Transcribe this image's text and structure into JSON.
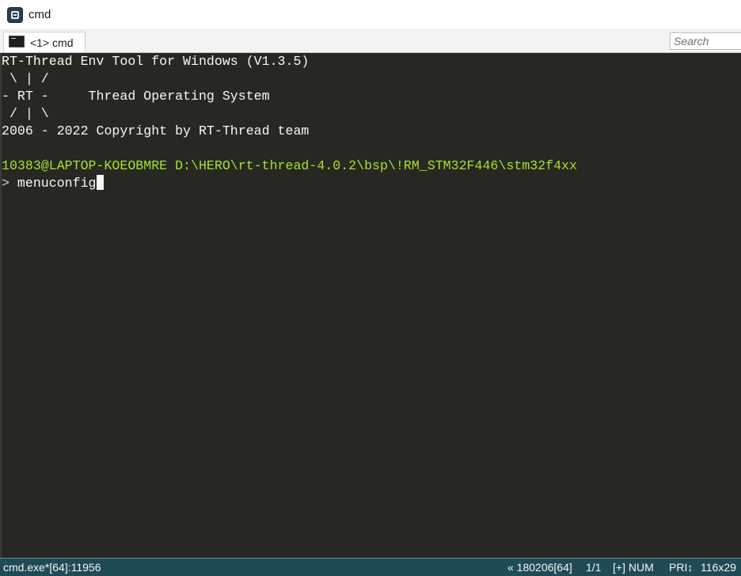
{
  "window": {
    "title": "cmd",
    "app_icon": "conemu-app-icon"
  },
  "tabs": [
    {
      "label": "<1> cmd",
      "icon": "console-icon",
      "active": true
    }
  ],
  "search": {
    "placeholder": "Search",
    "value": ""
  },
  "terminal": {
    "background": "#272822",
    "foreground": "#f8f8f2",
    "prompt_color": "#a6e22e",
    "lines": [
      "RT-Thread Env Tool for Windows (V1.3.5)",
      " \\ | /",
      "- RT -     Thread Operating System",
      " / | \\",
      "2006 - 2022 Copyright by RT-Thread team",
      "",
      ""
    ],
    "prompt_user": "10383@LAPTOP-KOEOBMRE",
    "prompt_path": "D:\\HERO\\rt-thread-4.0.2\\bsp\\!RM_STM32F446\\stm32f4xx",
    "prompt_symbol": ">",
    "command": " menuconfig"
  },
  "statusbar": {
    "background": "#1f4b57",
    "process": "cmd.exe*[64]:11956",
    "info": "« 180206[64]",
    "page": "1/1",
    "mode": "[+] NUM",
    "priority": "PRI↕",
    "size": "116x29"
  }
}
